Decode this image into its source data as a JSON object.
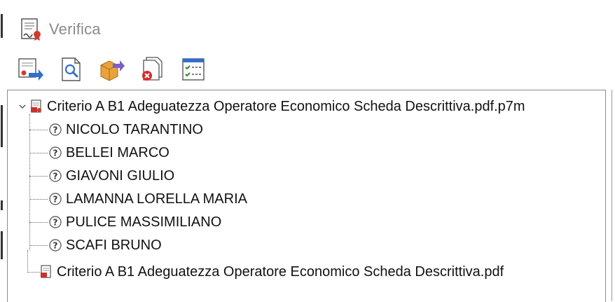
{
  "header": {
    "title": "Verifica",
    "icon": "signed-document-icon"
  },
  "toolbar": {
    "buttons": [
      {
        "name": "verify-signature-button",
        "icon": "certificate-arrow-icon"
      },
      {
        "name": "view-document-button",
        "icon": "magnifier-document-icon"
      },
      {
        "name": "extract-button",
        "icon": "box-arrow-icon"
      },
      {
        "name": "remove-button",
        "icon": "document-delete-icon"
      },
      {
        "name": "details-button",
        "icon": "checklist-icon"
      }
    ]
  },
  "tree": {
    "root_label": "Criterio A B1 Adeguatezza Operatore Economico Scheda Descrittiva.pdf.p7m",
    "signers": [
      "NICOLO TARANTINO",
      "BELLEI MARCO",
      "GIAVONI GIULIO",
      "LAMANNA LORELLA MARIA",
      "PULICE MASSIMILIANO",
      "SCAFI BRUNO"
    ],
    "child_doc_label": "Criterio A B1 Adeguatezza Operatore Economico Scheda Descrittiva.pdf"
  },
  "colors": {
    "title": "#8a8a8a",
    "accent_blue": "#2f6fd0",
    "doc_red": "#c8322a"
  }
}
